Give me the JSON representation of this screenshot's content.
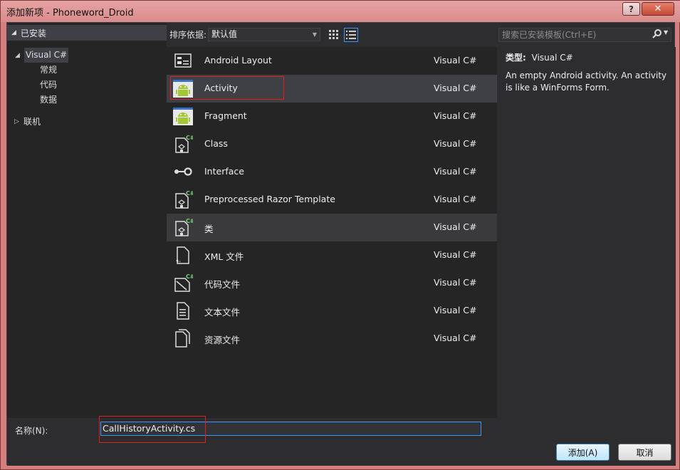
{
  "window": {
    "title": "添加新项 - Phoneword_Droid",
    "help_label": "?",
    "close_label": "✕"
  },
  "left": {
    "header": "已安装",
    "tree": [
      {
        "label": "Visual C#"
      },
      {
        "label": "常规"
      },
      {
        "label": "代码"
      },
      {
        "label": "数据"
      },
      {
        "label": "联机"
      }
    ]
  },
  "toolbar": {
    "sort_label": "排序依据:",
    "sort_value": "默认值"
  },
  "search": {
    "placeholder": "搜索已安装模板(Ctrl+E)"
  },
  "templates": [
    {
      "name": "Android Layout",
      "lang": "Visual C#",
      "icon": "layout-icon"
    },
    {
      "name": "Activity",
      "lang": "Visual C#",
      "icon": "android-icon"
    },
    {
      "name": "Fragment",
      "lang": "Visual C#",
      "icon": "android-icon"
    },
    {
      "name": "Class",
      "lang": "Visual C#",
      "icon": "csharp-class-icon"
    },
    {
      "name": "Interface",
      "lang": "Visual C#",
      "icon": "interface-icon"
    },
    {
      "name": "Preprocessed Razor Template",
      "lang": "Visual C#",
      "icon": "csharp-class-icon"
    },
    {
      "name": "类",
      "lang": "Visual C#",
      "icon": "csharp-class-icon"
    },
    {
      "name": "XML 文件",
      "lang": "Visual C#",
      "icon": "xml-file-icon"
    },
    {
      "name": "代码文件",
      "lang": "Visual C#",
      "icon": "code-file-icon"
    },
    {
      "name": "文本文件",
      "lang": "Visual C#",
      "icon": "text-file-icon"
    },
    {
      "name": "资源文件",
      "lang": "Visual C#",
      "icon": "resource-file-icon"
    }
  ],
  "info": {
    "type_label": "类型:",
    "type_value": "Visual C#",
    "description": "An empty Android activity.  An activity is like a WinForms Form."
  },
  "bottom": {
    "name_label": "名称(N):",
    "name_value": "CallHistoryActivity.cs",
    "add_label": "添加(A)",
    "cancel_label": "取消"
  },
  "colors": {
    "accent": "#3399ff",
    "android_green": "#a4c639",
    "highlight_box": "#e02020"
  }
}
